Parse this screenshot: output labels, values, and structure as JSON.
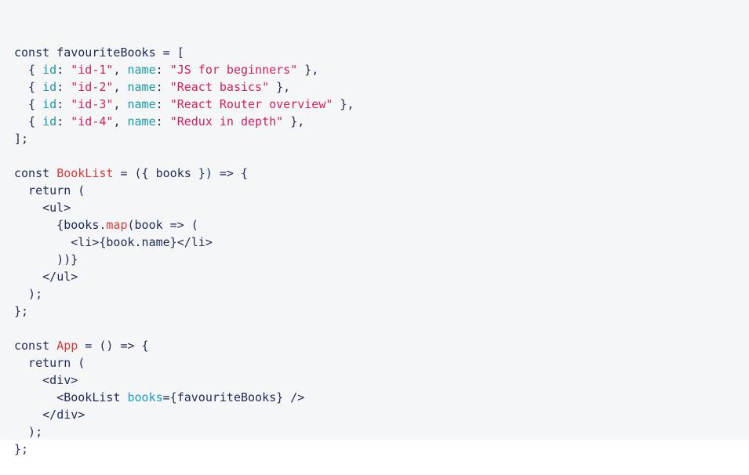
{
  "code": {
    "lines": [
      [
        {
          "t": "const favouriteBooks = [",
          "c": "plain"
        }
      ],
      [
        {
          "t": "  { ",
          "c": "plain"
        },
        {
          "t": "id",
          "c": "key"
        },
        {
          "t": ": ",
          "c": "plain"
        },
        {
          "t": "\"id-1\"",
          "c": "str"
        },
        {
          "t": ", ",
          "c": "plain"
        },
        {
          "t": "name",
          "c": "key"
        },
        {
          "t": ": ",
          "c": "plain"
        },
        {
          "t": "\"JS for beginners\"",
          "c": "str"
        },
        {
          "t": " },",
          "c": "plain"
        }
      ],
      [
        {
          "t": "  { ",
          "c": "plain"
        },
        {
          "t": "id",
          "c": "key"
        },
        {
          "t": ": ",
          "c": "plain"
        },
        {
          "t": "\"id-2\"",
          "c": "str"
        },
        {
          "t": ", ",
          "c": "plain"
        },
        {
          "t": "name",
          "c": "key"
        },
        {
          "t": ": ",
          "c": "plain"
        },
        {
          "t": "\"React basics\"",
          "c": "str"
        },
        {
          "t": " },",
          "c": "plain"
        }
      ],
      [
        {
          "t": "  { ",
          "c": "plain"
        },
        {
          "t": "id",
          "c": "key"
        },
        {
          "t": ": ",
          "c": "plain"
        },
        {
          "t": "\"id-3\"",
          "c": "str"
        },
        {
          "t": ", ",
          "c": "plain"
        },
        {
          "t": "name",
          "c": "key"
        },
        {
          "t": ": ",
          "c": "plain"
        },
        {
          "t": "\"React Router overview\"",
          "c": "str"
        },
        {
          "t": " },",
          "c": "plain"
        }
      ],
      [
        {
          "t": "  { ",
          "c": "plain"
        },
        {
          "t": "id",
          "c": "key"
        },
        {
          "t": ": ",
          "c": "plain"
        },
        {
          "t": "\"id-4\"",
          "c": "str"
        },
        {
          "t": ", ",
          "c": "plain"
        },
        {
          "t": "name",
          "c": "key"
        },
        {
          "t": ": ",
          "c": "plain"
        },
        {
          "t": "\"Redux in depth\"",
          "c": "str"
        },
        {
          "t": " },",
          "c": "plain"
        }
      ],
      [
        {
          "t": "];",
          "c": "plain"
        }
      ],
      [
        {
          "t": "",
          "c": "plain"
        }
      ],
      [
        {
          "t": "const ",
          "c": "plain"
        },
        {
          "t": "BookList",
          "c": "fn"
        },
        {
          "t": " = ({ books }) => {",
          "c": "plain"
        }
      ],
      [
        {
          "t": "  return (",
          "c": "plain"
        }
      ],
      [
        {
          "t": "    <",
          "c": "plain"
        },
        {
          "t": "ul",
          "c": "tag"
        },
        {
          "t": ">",
          "c": "plain"
        }
      ],
      [
        {
          "t": "      {books.",
          "c": "plain"
        },
        {
          "t": "map",
          "c": "fn"
        },
        {
          "t": "(book => (",
          "c": "plain"
        }
      ],
      [
        {
          "t": "        <",
          "c": "plain"
        },
        {
          "t": "li",
          "c": "tag"
        },
        {
          "t": ">{book.name}</",
          "c": "plain"
        },
        {
          "t": "li",
          "c": "tag"
        },
        {
          "t": ">",
          "c": "plain"
        }
      ],
      [
        {
          "t": "      ))}",
          "c": "plain"
        }
      ],
      [
        {
          "t": "    </",
          "c": "plain"
        },
        {
          "t": "ul",
          "c": "tag"
        },
        {
          "t": ">",
          "c": "plain"
        }
      ],
      [
        {
          "t": "  );",
          "c": "plain"
        }
      ],
      [
        {
          "t": "};",
          "c": "plain"
        }
      ],
      [
        {
          "t": "",
          "c": "plain"
        }
      ],
      [
        {
          "t": "const ",
          "c": "plain"
        },
        {
          "t": "App",
          "c": "fn"
        },
        {
          "t": " = () => {",
          "c": "plain"
        }
      ],
      [
        {
          "t": "  return (",
          "c": "plain"
        }
      ],
      [
        {
          "t": "    <",
          "c": "plain"
        },
        {
          "t": "div",
          "c": "tag"
        },
        {
          "t": ">",
          "c": "plain"
        }
      ],
      [
        {
          "t": "      <",
          "c": "plain"
        },
        {
          "t": "BookList",
          "c": "tag"
        },
        {
          "t": " ",
          "c": "plain"
        },
        {
          "t": "books",
          "c": "attr"
        },
        {
          "t": "={favouriteBooks} />",
          "c": "plain"
        }
      ],
      [
        {
          "t": "    </",
          "c": "plain"
        },
        {
          "t": "div",
          "c": "tag"
        },
        {
          "t": ">",
          "c": "plain"
        }
      ],
      [
        {
          "t": "  );",
          "c": "plain"
        }
      ],
      [
        {
          "t": "};",
          "c": "plain"
        }
      ]
    ]
  }
}
